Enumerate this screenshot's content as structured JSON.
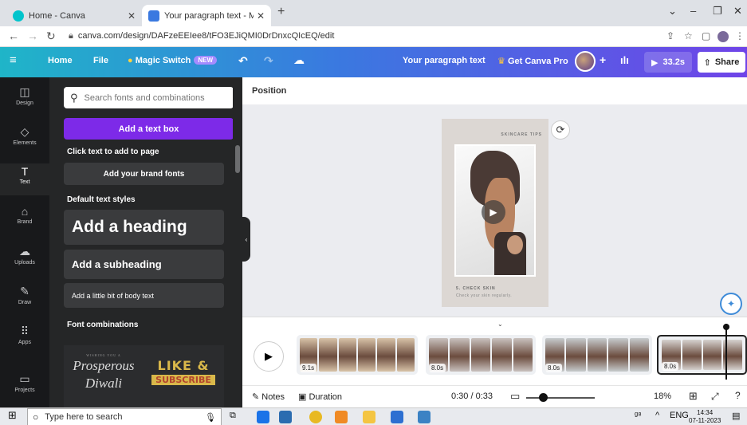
{
  "browser": {
    "tabs": [
      {
        "title": "Home - Canva",
        "active": false
      },
      {
        "title": "Your paragraph text - Mobile Vid",
        "active": true
      }
    ],
    "url": "canva.com/design/DAFzeEEIee8/tFO3EJiQMI0DrDnxcQIcEQ/edit"
  },
  "topbar": {
    "home": "Home",
    "file": "File",
    "magic_switch": "Magic Switch",
    "new_badge": "NEW",
    "design_title": "Your paragraph text",
    "get_pro": "Get Canva Pro",
    "duration": "33.2s",
    "share": "Share"
  },
  "rail": [
    {
      "label": "Design",
      "icon": "design-icon"
    },
    {
      "label": "Elements",
      "icon": "elements-icon"
    },
    {
      "label": "Text",
      "icon": "text-icon"
    },
    {
      "label": "Brand",
      "icon": "brand-icon"
    },
    {
      "label": "Uploads",
      "icon": "uploads-icon"
    },
    {
      "label": "Draw",
      "icon": "draw-icon"
    },
    {
      "label": "Apps",
      "icon": "apps-icon"
    },
    {
      "label": "Projects",
      "icon": "projects-icon"
    }
  ],
  "panel": {
    "search_placeholder": "Search fonts and combinations",
    "add_text_box": "Add a text box",
    "click_to_add": "Click text to add to page",
    "brand_fonts": "Add your brand fonts",
    "default_styles": "Default text styles",
    "heading": "Add a heading",
    "subheading": "Add a subheading",
    "body": "Add a little bit of body text",
    "font_combinations": "Font combinations",
    "combo1_small": "WISHING YOU A",
    "combo1_line1": "Prosperous",
    "combo1_line2": "Diwali",
    "combo2_line1": "LIKE &",
    "combo2_line2": "SUBSCRIBE"
  },
  "editor": {
    "position": "Position",
    "page_tag": "SKINCARE TIPS",
    "caption_title": "5. CHECK SKIN",
    "caption_body": "Check your skin regularly."
  },
  "timeline": {
    "clips": [
      {
        "duration": "9.1s",
        "color": "#d8c3a8"
      },
      {
        "duration": "8.0s",
        "color": "#c9c2bf"
      },
      {
        "duration": "8.0s",
        "color": "#c7ccce"
      },
      {
        "duration": "8.0s",
        "color": "#d6d2cf"
      }
    ]
  },
  "footer": {
    "notes": "Notes",
    "duration": "Duration",
    "time": "0:30 / 0:33",
    "zoom": "18%"
  },
  "taskbar": {
    "search_placeholder": "Type here to search",
    "language": "ENG",
    "time": "14:34",
    "date": "07-11-2023"
  }
}
